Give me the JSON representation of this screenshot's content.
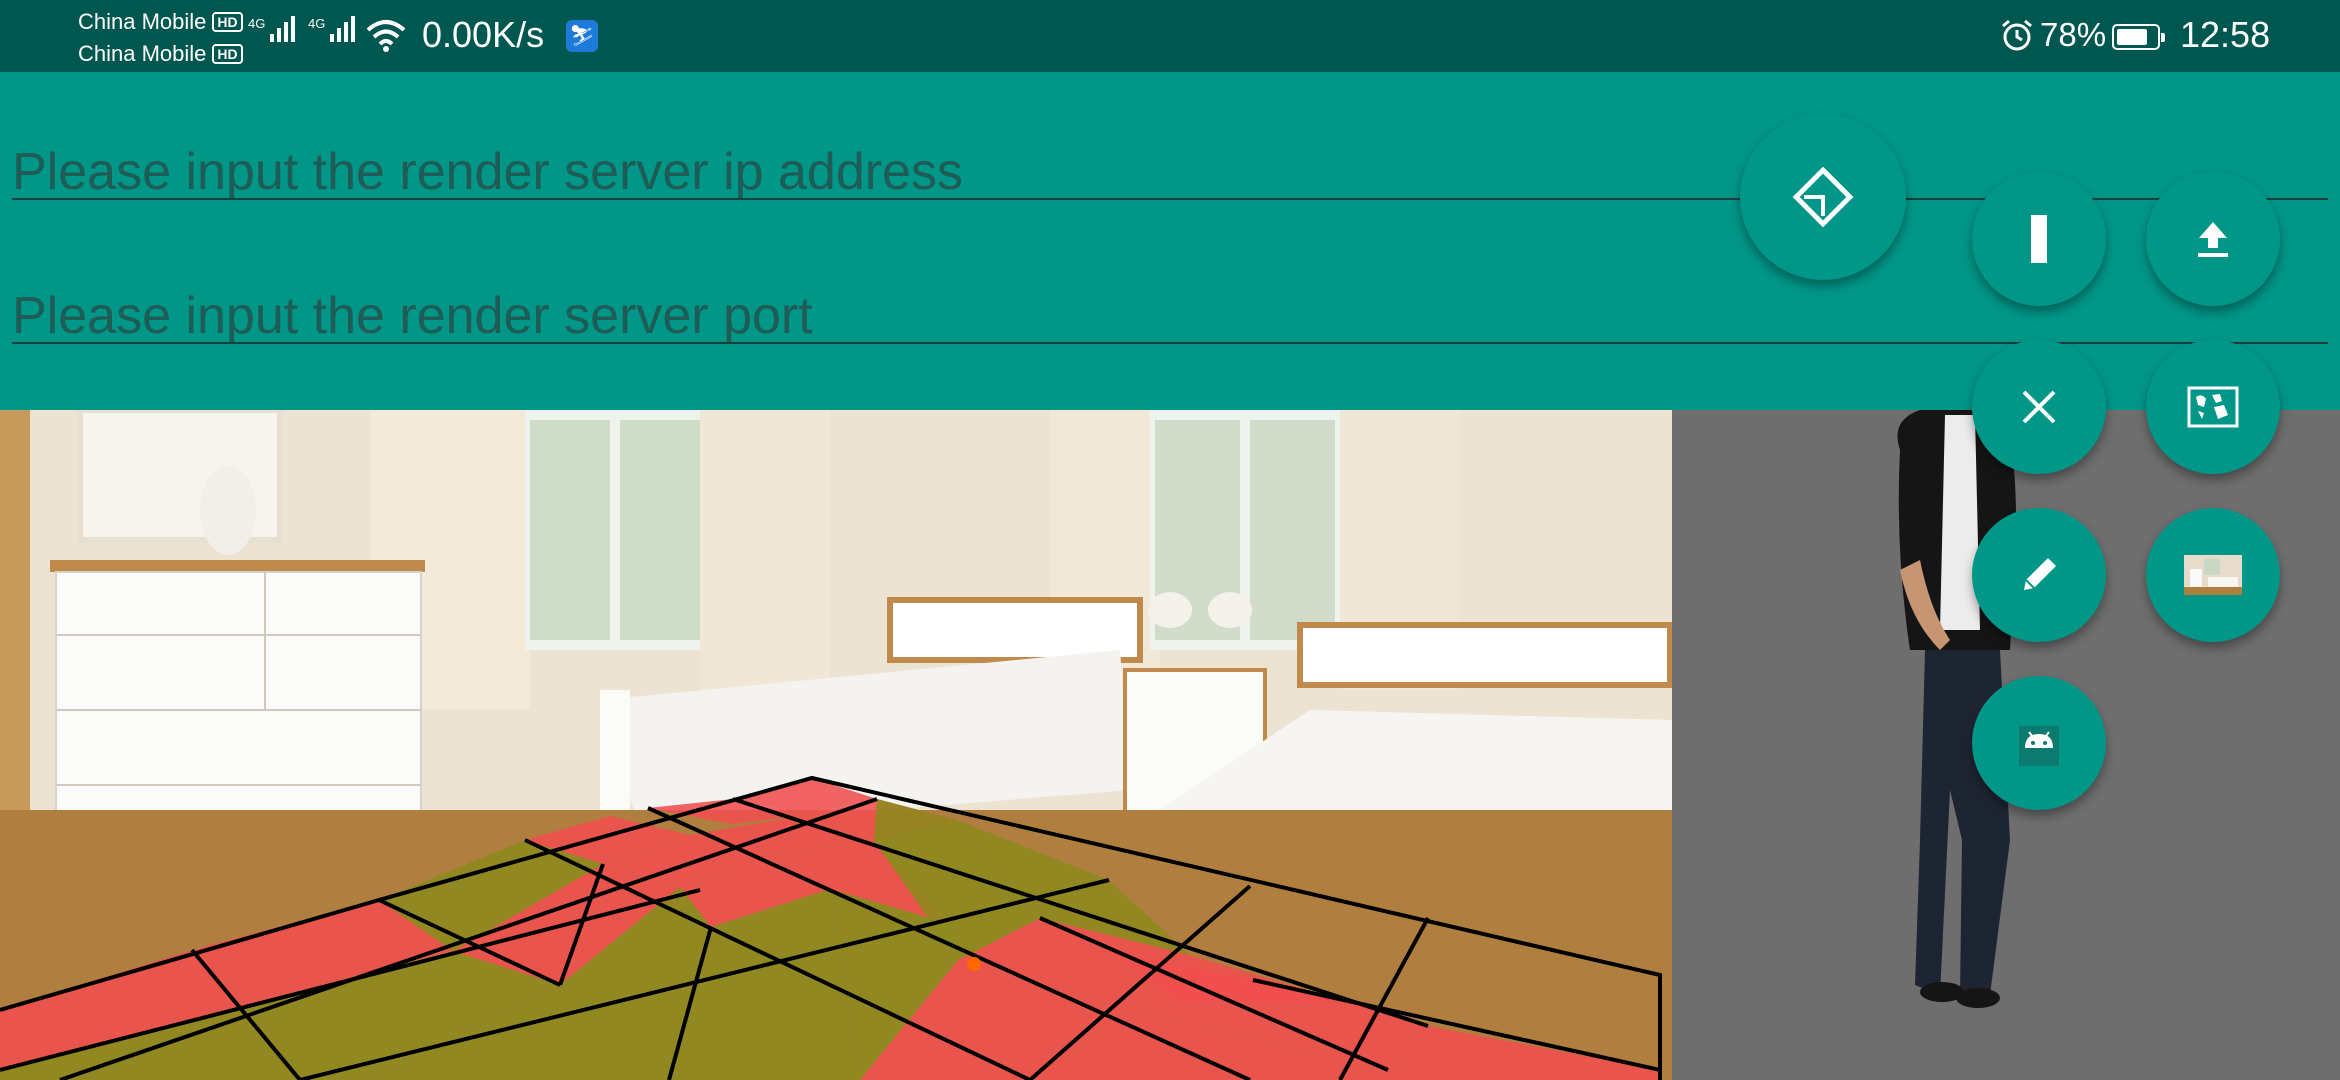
{
  "status_bar": {
    "carrier_1": "China Mobile",
    "carrier_2": "China Mobile",
    "hd_badge": "HD",
    "network_type": "4G",
    "net_speed": "0.00K/s",
    "battery_percent": "78%",
    "time": "12:58"
  },
  "form": {
    "ip_placeholder": "Please input the render server ip address",
    "port_placeholder": "Please input the render server port"
  },
  "colors": {
    "primary": "#009688",
    "status_bar": "#00574f",
    "floor_red": "#f04e4e",
    "floor_olive": "#8c8a1e"
  },
  "actions": [
    {
      "name": "measure-fab",
      "icon": "ruler-diamond-icon"
    },
    {
      "name": "pause-fab",
      "icon": "bar-icon"
    },
    {
      "name": "upload-fab",
      "icon": "upload-icon"
    },
    {
      "name": "close-fab",
      "icon": "close-icon"
    },
    {
      "name": "map-fab",
      "icon": "world-map-icon"
    },
    {
      "name": "edit-fab",
      "icon": "pencil-icon"
    },
    {
      "name": "room-fab",
      "icon": "room-thumbnail-icon"
    },
    {
      "name": "android-fab",
      "icon": "android-icon"
    }
  ]
}
